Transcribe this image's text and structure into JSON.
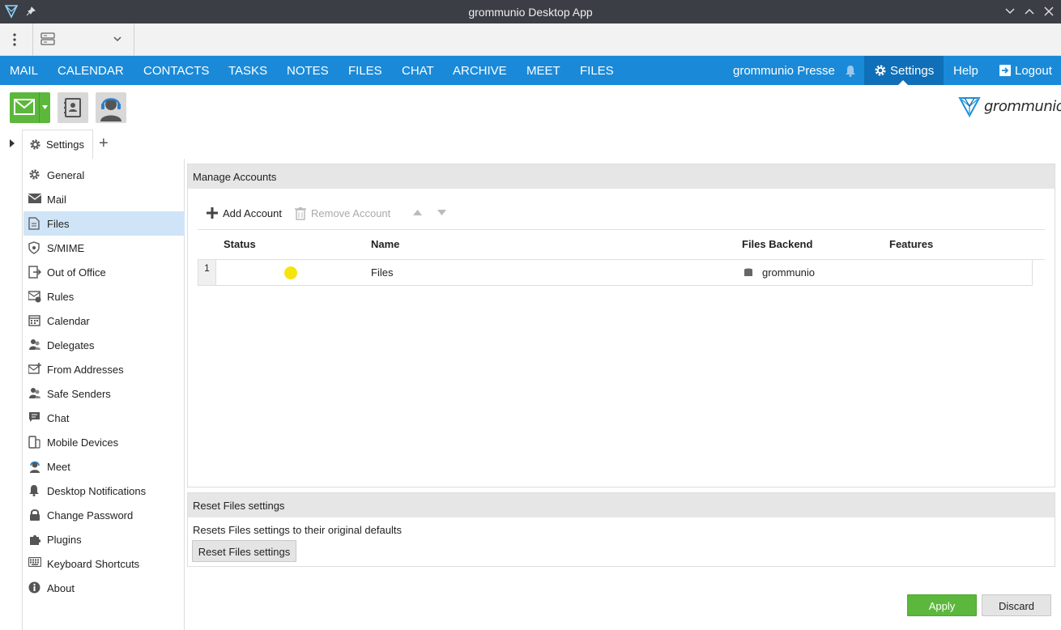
{
  "window": {
    "title": "grommunio Desktop App"
  },
  "nav": {
    "items": [
      "MAIL",
      "CALENDAR",
      "CONTACTS",
      "TASKS",
      "NOTES",
      "FILES",
      "CHAT",
      "ARCHIVE",
      "MEET",
      "FILES"
    ],
    "user": "grommunio Presse",
    "settings": "Settings",
    "help": "Help",
    "logout": "Logout"
  },
  "logo": {
    "text": "grommunio"
  },
  "tabs": {
    "active": "Settings"
  },
  "sidebar": {
    "items": [
      {
        "label": "General",
        "icon": "gear-icon"
      },
      {
        "label": "Mail",
        "icon": "envelope-icon"
      },
      {
        "label": "Files",
        "icon": "file-icon"
      },
      {
        "label": "S/MIME",
        "icon": "shield-icon"
      },
      {
        "label": "Out of Office",
        "icon": "out-of-office-icon"
      },
      {
        "label": "Rules",
        "icon": "rules-icon"
      },
      {
        "label": "Calendar",
        "icon": "calendar-icon"
      },
      {
        "label": "Delegates",
        "icon": "users-icon"
      },
      {
        "label": "From Addresses",
        "icon": "envelope-plus-icon"
      },
      {
        "label": "Safe Senders",
        "icon": "users-icon"
      },
      {
        "label": "Chat",
        "icon": "chat-icon"
      },
      {
        "label": "Mobile Devices",
        "icon": "mobile-icon"
      },
      {
        "label": "Meet",
        "icon": "headset-icon"
      },
      {
        "label": "Desktop Notifications",
        "icon": "bell-icon"
      },
      {
        "label": "Change Password",
        "icon": "lock-icon"
      },
      {
        "label": "Plugins",
        "icon": "puzzle-icon"
      },
      {
        "label": "Keyboard Shortcuts",
        "icon": "keyboard-icon"
      },
      {
        "label": "About",
        "icon": "info-icon"
      }
    ],
    "active_index": 2
  },
  "accounts": {
    "heading": "Manage Accounts",
    "add_label": "Add Account",
    "remove_label": "Remove Account",
    "columns": [
      "Status",
      "Name",
      "Files Backend",
      "Features"
    ],
    "rows": [
      {
        "num": "1",
        "status_color": "#f5e50e",
        "name": "Files",
        "backend": "grommunio",
        "features": ""
      }
    ]
  },
  "reset": {
    "heading": "Reset Files settings",
    "description": "Resets Files settings to their original defaults",
    "button": "Reset Files settings"
  },
  "footer": {
    "apply": "Apply",
    "discard": "Discard"
  }
}
